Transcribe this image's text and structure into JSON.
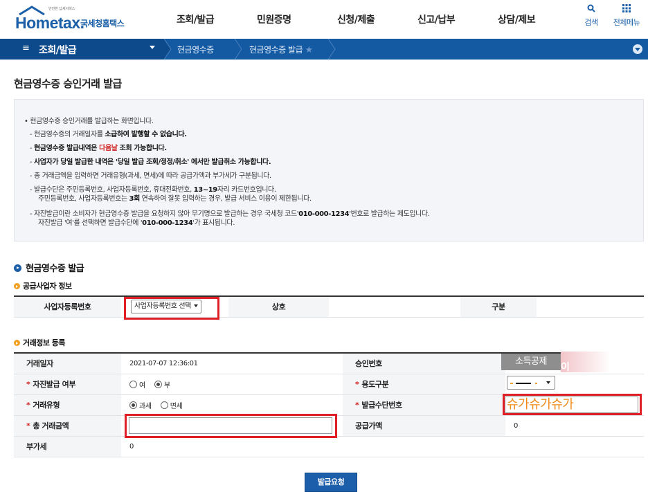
{
  "header": {
    "logo_small": "안전한 납세서비스",
    "logo_main": "Hometax.",
    "logo_sub": "국세청홈택스",
    "menu": [
      "조회/발급",
      "민원증명",
      "신청/제출",
      "신고/납부",
      "상담/제보"
    ],
    "search_label": "검색",
    "allmenu_label": "전체메뉴"
  },
  "nav": {
    "menu_icon": "≡",
    "title": "조회/발급",
    "crumbs": [
      "현금영수증",
      "현금영수증 발급"
    ],
    "star_icon": "★"
  },
  "page": {
    "title": "현금영수증 승인거래 발급"
  },
  "info": {
    "lines": [
      {
        "bullet": "•",
        "text": "현금영수증 승인거래를 발급하는 화면입니다."
      },
      {
        "bullet": "-",
        "pre": "현금영수증의 거래일자를 ",
        "bold": "소급하여 발행할 수 없습니다.",
        "post": ""
      },
      {
        "bullet": "-",
        "pre": "",
        "bold": "현금영수증 발급내역은 ",
        "red": "다음날",
        "post": " 조회 가능합니다."
      },
      {
        "bullet": "-",
        "bold": "사업자가 당일 발급한 내역은 '당일 발급 조회/정정/취소' 에서만 발급취소 가능합니다."
      },
      {
        "bullet": "-",
        "text": "총 거래금액을 입력하면 거래유형(과세, 면세)에 따라 공급가액과 부가세가 구분됩니다."
      },
      {
        "bullet": "-",
        "pre": "발급수단은 주민등록번호, 사업자등록번호, 휴대전화번호, ",
        "bold": "13~19",
        "post": "자리 카드번호입니다."
      },
      {
        "bullet": "",
        "pre": "주민등록번호, 사업자등록번호는 ",
        "bold": "3회",
        "post": " 연속하여 잘못 입력하는 경우, 발급 서비스 이용이 제한됩니다."
      },
      {
        "bullet": "-",
        "pre": "자진발급이란 소비자가 현금영수증 발급을 요청하지 않아 무기명으로 발급하는 경우 국세청 코드'",
        "bold": "010-000-1234",
        "post": "'번호로 발급하는 제도입니다."
      },
      {
        "bullet": "",
        "pre": "자진발급 '여'를 선택하면 발급수단에 '",
        "bold": "010-000-1234",
        "post": "'가 표시됩니다."
      }
    ]
  },
  "section": {
    "title": "현금영수증 발급",
    "supplier_title": "공급사업자 정보",
    "trade_title": "거래정보 등록"
  },
  "supplier": {
    "bizno_label": "사업자등록번호",
    "bizno_select": "사업자등록번호 선택",
    "name_label": "상호",
    "name_value": "",
    "type_label": "구분",
    "type_value": ""
  },
  "trade": {
    "date_label": "거래일자",
    "date_value": "2021-07-07 12:36:01",
    "approval_label": "승인번호",
    "self_issue_label": "자진발급 여부",
    "self_issue_options": [
      "여",
      "부"
    ],
    "self_issue_selected": "부",
    "usage_label": "용도구분",
    "type_label": "거래유형",
    "type_options": [
      "과세",
      "면세"
    ],
    "type_selected": "과세",
    "means_label": "발급수단번호",
    "means_value": "슈가슈가슈가",
    "total_label": "총 거래금액",
    "supply_label": "공급가액",
    "supply_value": "0",
    "vat_label": "부가세",
    "vat_value": "0",
    "deduct_label": "소득공제",
    "deduct_overlay": "이"
  },
  "actions": {
    "issue_button": "발급요청"
  },
  "colors": {
    "brand": "#1a5fa8",
    "nav": "#135aa3",
    "highlight_red": "#e01e25",
    "required_red": "#d21f1f",
    "means_orange": "#f28a1b"
  }
}
